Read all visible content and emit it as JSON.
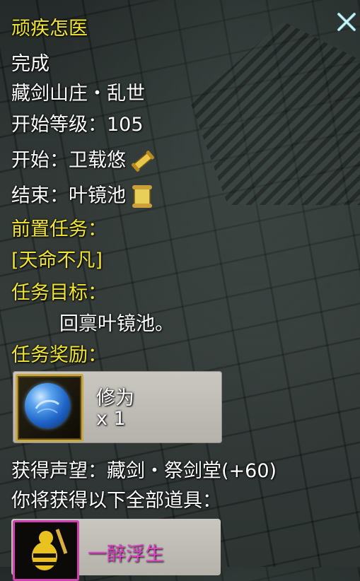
{
  "quest": {
    "title": "顽疾怎医",
    "status": "完成",
    "zone": "藏剑山庄・乱世",
    "level_label": "开始等级：105",
    "start_label": "开始：卫载悠",
    "end_label": "结束：叶镜池",
    "prereq_heading": "前置任务：",
    "prereq_quest": "[天命不凡]",
    "objective_heading": "任务目标：",
    "objective_text": "回禀叶镜池。",
    "reward_heading": "任务奖励："
  },
  "reward": {
    "name": "修为",
    "quantity": "x 1",
    "icon": "blue-orb-icon"
  },
  "reputation_text": "获得声望：藏剑・祭剑堂(+60)",
  "items_heading": "你将获得以下全部道具：",
  "item": {
    "name": "一醉浮生",
    "icon": "bee-figure-icon",
    "quality_color": "#e23ec9"
  },
  "colors": {
    "heading": "#f1e533",
    "text": "#ffffff",
    "frame_gold": "#c9a640"
  }
}
